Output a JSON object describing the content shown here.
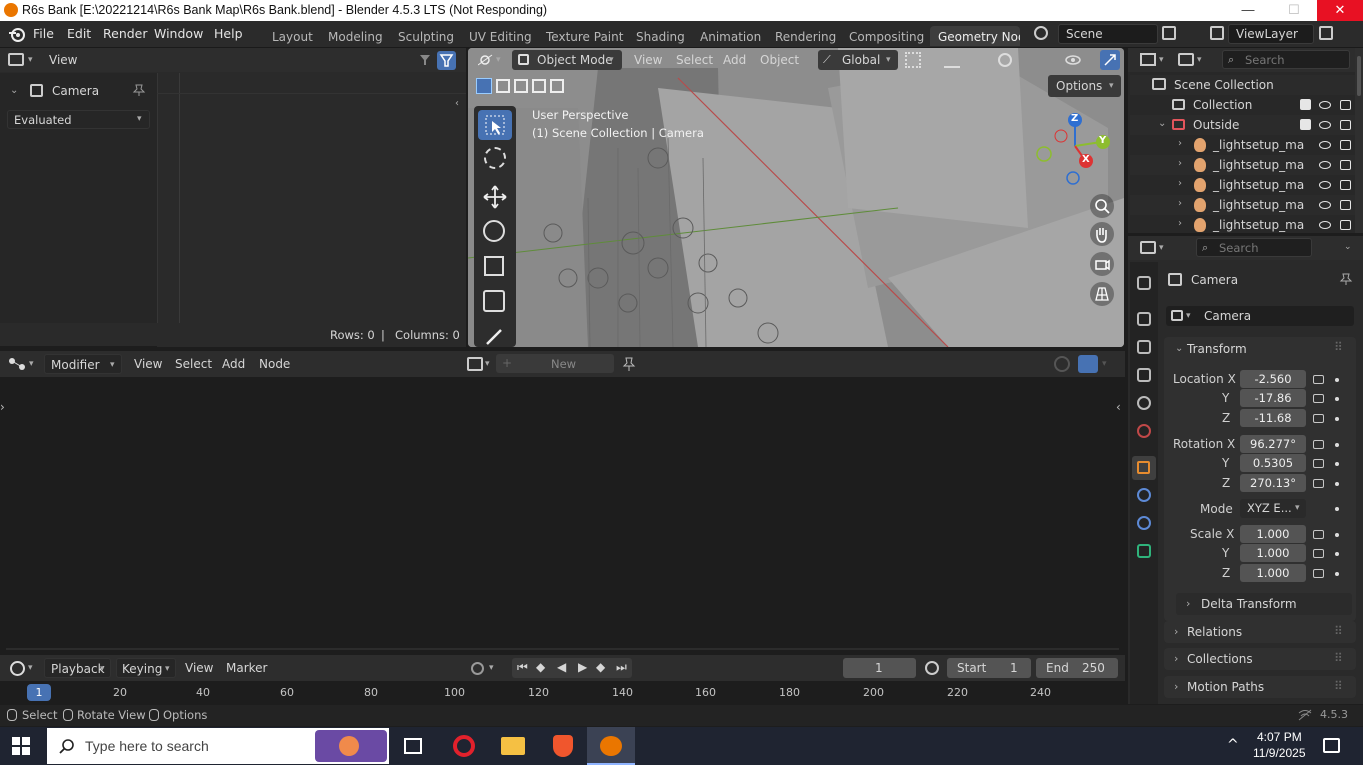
{
  "window": {
    "title": "R6s Bank [E:\\20221214\\R6s Bank Map\\R6s Bank.blend] - Blender 4.5.3 LTS (Not Responding)",
    "minimize": "—",
    "maximize": "☐",
    "close": "✕"
  },
  "menu": [
    "File",
    "Edit",
    "Render",
    "Window",
    "Help"
  ],
  "workspaces": [
    "Layout",
    "Modeling",
    "Sculpting",
    "UV Editing",
    "Texture Paint",
    "Shading",
    "Animation",
    "Rendering",
    "Compositing",
    "Geometry Node"
  ],
  "scene": {
    "label": "Scene",
    "view_layer": "ViewLayer"
  },
  "spreadsheet": {
    "header_view": "View",
    "object": "Camera",
    "mode": "Evaluated",
    "rows": "Rows: 0",
    "columns": "Columns: 0",
    "sep": "|"
  },
  "viewport": {
    "mode": "Object Mode",
    "menus": [
      "View",
      "Select",
      "Add",
      "Object"
    ],
    "transform": "Global",
    "options": "Options",
    "info_line1": "User Perspective",
    "info_line2": "(1) Scene Collection | Camera",
    "axis_x": "X",
    "axis_y": "Y",
    "axis_z": "Z"
  },
  "node_editor": {
    "type": "Modifier",
    "menus": [
      "View",
      "Select",
      "Add",
      "Node"
    ],
    "new_button": "New"
  },
  "timeline": {
    "menus": [
      "Playback",
      "Keying",
      "View",
      "Marker"
    ],
    "current_frame": "1",
    "start_label": "Start",
    "start": "1",
    "end_label": "End",
    "end": "250",
    "ticks": [
      "20",
      "40",
      "60",
      "80",
      "100",
      "120",
      "140",
      "160",
      "180",
      "200",
      "220",
      "240"
    ],
    "current_tick": "1"
  },
  "outliner": {
    "search_placeholder": "Search",
    "items": [
      {
        "label": "Scene Collection"
      },
      {
        "label": "Collection"
      },
      {
        "label": "Outside"
      },
      {
        "label": "_lightsetup_ma"
      },
      {
        "label": "_lightsetup_ma"
      },
      {
        "label": "_lightsetup_ma"
      },
      {
        "label": "_lightsetup_ma"
      },
      {
        "label": "_lightsetup_ma"
      }
    ]
  },
  "properties": {
    "search_placeholder": "Search",
    "object_name": "Camera",
    "data_name": "Camera",
    "transform_label": "Transform",
    "location": {
      "label": "Location X",
      "x": "-2.560",
      "y": "-17.86",
      "z": "-11.68"
    },
    "rotation": {
      "label": "Rotation X",
      "x": "96.277°",
      "y": "0.5305",
      "z": "270.13°"
    },
    "mode_label": "Mode",
    "mode_value": "XYZ E...",
    "scale": {
      "label": "Scale X",
      "x": "1.000",
      "y": "1.000",
      "z": "1.000"
    },
    "y_label": "Y",
    "z_label": "Z",
    "delta": "Delta Transform",
    "sections": [
      "Relations",
      "Collections",
      "Motion Paths"
    ]
  },
  "status": {
    "select": "Select",
    "rotate": "Rotate View",
    "options": "Options",
    "version": "4.5.3"
  },
  "taskbar": {
    "search_placeholder": "Type here to search",
    "time": "4:07 PM",
    "date": "11/9/2025"
  }
}
